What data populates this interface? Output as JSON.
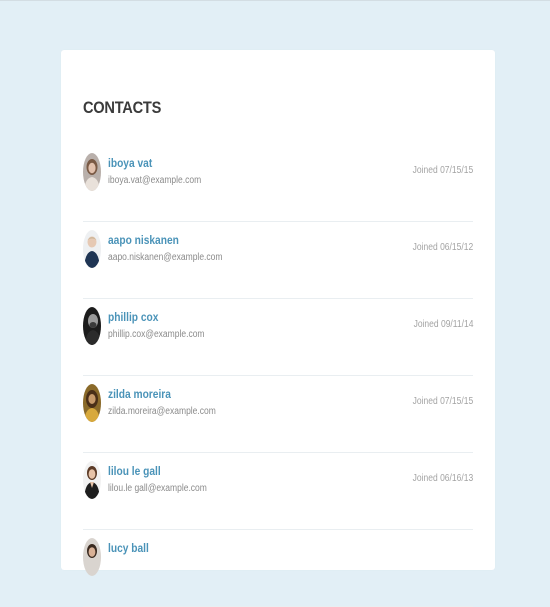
{
  "contacts": {
    "title": "CONTACTS",
    "items": [
      {
        "name": "iboya vat",
        "email": "iboya.vat@example.com",
        "joined": "Joined 07/15/15",
        "avatar_icon": "person-avatar-icon"
      },
      {
        "name": "aapo niskanen",
        "email": "aapo.niskanen@example.com",
        "joined": "Joined 06/15/12",
        "avatar_icon": "person-avatar-icon"
      },
      {
        "name": "phillip cox",
        "email": "phillip.cox@example.com",
        "joined": "Joined 09/11/14",
        "avatar_icon": "person-avatar-icon"
      },
      {
        "name": "zilda moreira",
        "email": "zilda.moreira@example.com",
        "joined": "Joined 07/15/15",
        "avatar_icon": "person-avatar-icon"
      },
      {
        "name": "lilou le gall",
        "email": "lilou.le gall@example.com",
        "joined": "Joined 06/16/13",
        "avatar_icon": "person-avatar-icon"
      },
      {
        "name": "lucy ball",
        "email": "",
        "joined": "",
        "avatar_icon": "person-avatar-icon"
      }
    ]
  },
  "colors": {
    "page_background": "#e2eff6",
    "card_background": "#ffffff",
    "name_link": "#4a93b8",
    "title_text": "#3b3b3b",
    "email_text": "#8b8b8b",
    "joined_text": "#a3a3a3"
  }
}
